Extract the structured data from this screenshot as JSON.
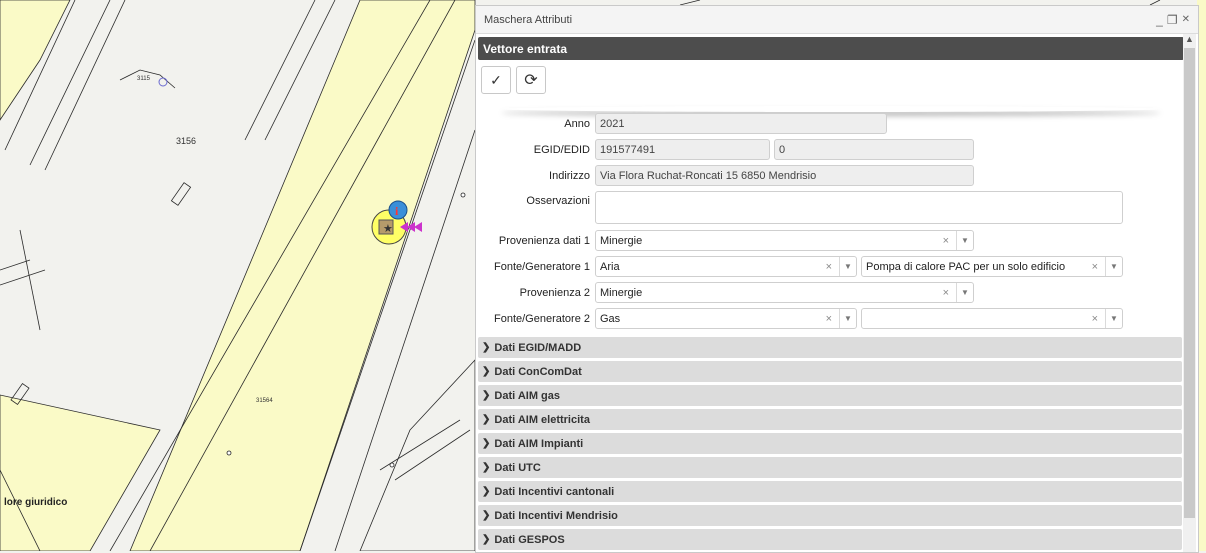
{
  "map": {
    "labels": {
      "parcel_3156": "3156",
      "parcel_31564": "31564",
      "parcel_small": "3115",
      "layer_label": "lore giuridico"
    },
    "colors": {
      "land": "#fafac7",
      "road": "#f2f2ee",
      "line": "#2a2a2a"
    }
  },
  "dialog": {
    "title": "Maschera Attributi",
    "minimize": "_",
    "restore": "❐",
    "close": "✕",
    "section_title": "Vettore entrata",
    "toolbar": {
      "confirm": "✓",
      "refresh": "⟳"
    },
    "fields": {
      "anno": {
        "label": "Anno",
        "value": "2021"
      },
      "egid": {
        "label": "EGID/EDID",
        "value1": "191577491",
        "value2": "0"
      },
      "indirizzo": {
        "label": "Indirizzo",
        "value": "Via Flora Ruchat-Roncati 15 6850 Mendrisio"
      },
      "osservazioni": {
        "label": "Osservazioni",
        "value": ""
      },
      "provenienza1": {
        "label": "Provenienza dati 1",
        "value": "Minergie"
      },
      "fonte1": {
        "label": "Fonte/Generatore 1",
        "value": "Aria",
        "value2": "Pompa di calore PAC per un solo edificio"
      },
      "provenienza2": {
        "label": "Provenienza 2",
        "value": "Minergie"
      },
      "fonte2": {
        "label": "Fonte/Generatore 2",
        "value": "Gas",
        "value2": ""
      }
    },
    "accordion": [
      "Dati EGID/MADD",
      "Dati ConComDat",
      "Dati AIM gas",
      "Dati AIM elettricita",
      "Dati AIM Impianti",
      "Dati UTC",
      "Dati Incentivi cantonali",
      "Dati Incentivi Mendrisio",
      "Dati GESPOS"
    ],
    "clear_symbol": "×",
    "caret_symbol": "▼",
    "chevron_symbol": "❯"
  }
}
